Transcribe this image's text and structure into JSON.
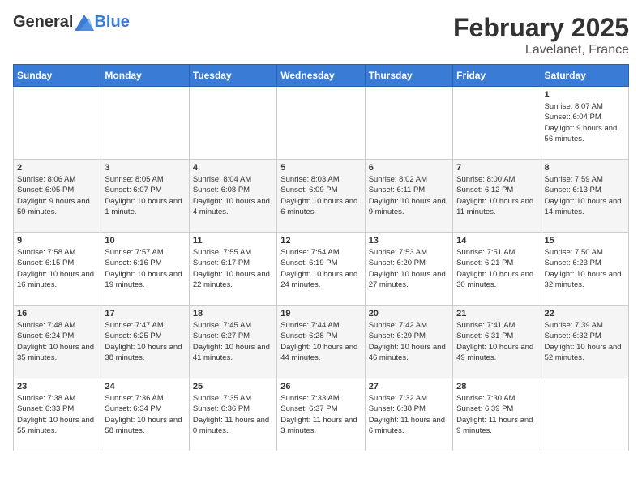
{
  "header": {
    "logo_general": "General",
    "logo_blue": "Blue",
    "title": "February 2025",
    "subtitle": "Lavelanet, France"
  },
  "columns": [
    "Sunday",
    "Monday",
    "Tuesday",
    "Wednesday",
    "Thursday",
    "Friday",
    "Saturday"
  ],
  "weeks": [
    [
      {
        "day": "",
        "info": ""
      },
      {
        "day": "",
        "info": ""
      },
      {
        "day": "",
        "info": ""
      },
      {
        "day": "",
        "info": ""
      },
      {
        "day": "",
        "info": ""
      },
      {
        "day": "",
        "info": ""
      },
      {
        "day": "1",
        "info": "Sunrise: 8:07 AM\nSunset: 6:04 PM\nDaylight: 9 hours and 56 minutes."
      }
    ],
    [
      {
        "day": "2",
        "info": "Sunrise: 8:06 AM\nSunset: 6:05 PM\nDaylight: 9 hours and 59 minutes."
      },
      {
        "day": "3",
        "info": "Sunrise: 8:05 AM\nSunset: 6:07 PM\nDaylight: 10 hours and 1 minute."
      },
      {
        "day": "4",
        "info": "Sunrise: 8:04 AM\nSunset: 6:08 PM\nDaylight: 10 hours and 4 minutes."
      },
      {
        "day": "5",
        "info": "Sunrise: 8:03 AM\nSunset: 6:09 PM\nDaylight: 10 hours and 6 minutes."
      },
      {
        "day": "6",
        "info": "Sunrise: 8:02 AM\nSunset: 6:11 PM\nDaylight: 10 hours and 9 minutes."
      },
      {
        "day": "7",
        "info": "Sunrise: 8:00 AM\nSunset: 6:12 PM\nDaylight: 10 hours and 11 minutes."
      },
      {
        "day": "8",
        "info": "Sunrise: 7:59 AM\nSunset: 6:13 PM\nDaylight: 10 hours and 14 minutes."
      }
    ],
    [
      {
        "day": "9",
        "info": "Sunrise: 7:58 AM\nSunset: 6:15 PM\nDaylight: 10 hours and 16 minutes."
      },
      {
        "day": "10",
        "info": "Sunrise: 7:57 AM\nSunset: 6:16 PM\nDaylight: 10 hours and 19 minutes."
      },
      {
        "day": "11",
        "info": "Sunrise: 7:55 AM\nSunset: 6:17 PM\nDaylight: 10 hours and 22 minutes."
      },
      {
        "day": "12",
        "info": "Sunrise: 7:54 AM\nSunset: 6:19 PM\nDaylight: 10 hours and 24 minutes."
      },
      {
        "day": "13",
        "info": "Sunrise: 7:53 AM\nSunset: 6:20 PM\nDaylight: 10 hours and 27 minutes."
      },
      {
        "day": "14",
        "info": "Sunrise: 7:51 AM\nSunset: 6:21 PM\nDaylight: 10 hours and 30 minutes."
      },
      {
        "day": "15",
        "info": "Sunrise: 7:50 AM\nSunset: 6:23 PM\nDaylight: 10 hours and 32 minutes."
      }
    ],
    [
      {
        "day": "16",
        "info": "Sunrise: 7:48 AM\nSunset: 6:24 PM\nDaylight: 10 hours and 35 minutes."
      },
      {
        "day": "17",
        "info": "Sunrise: 7:47 AM\nSunset: 6:25 PM\nDaylight: 10 hours and 38 minutes."
      },
      {
        "day": "18",
        "info": "Sunrise: 7:45 AM\nSunset: 6:27 PM\nDaylight: 10 hours and 41 minutes."
      },
      {
        "day": "19",
        "info": "Sunrise: 7:44 AM\nSunset: 6:28 PM\nDaylight: 10 hours and 44 minutes."
      },
      {
        "day": "20",
        "info": "Sunrise: 7:42 AM\nSunset: 6:29 PM\nDaylight: 10 hours and 46 minutes."
      },
      {
        "day": "21",
        "info": "Sunrise: 7:41 AM\nSunset: 6:31 PM\nDaylight: 10 hours and 49 minutes."
      },
      {
        "day": "22",
        "info": "Sunrise: 7:39 AM\nSunset: 6:32 PM\nDaylight: 10 hours and 52 minutes."
      }
    ],
    [
      {
        "day": "23",
        "info": "Sunrise: 7:38 AM\nSunset: 6:33 PM\nDaylight: 10 hours and 55 minutes."
      },
      {
        "day": "24",
        "info": "Sunrise: 7:36 AM\nSunset: 6:34 PM\nDaylight: 10 hours and 58 minutes."
      },
      {
        "day": "25",
        "info": "Sunrise: 7:35 AM\nSunset: 6:36 PM\nDaylight: 11 hours and 0 minutes."
      },
      {
        "day": "26",
        "info": "Sunrise: 7:33 AM\nSunset: 6:37 PM\nDaylight: 11 hours and 3 minutes."
      },
      {
        "day": "27",
        "info": "Sunrise: 7:32 AM\nSunset: 6:38 PM\nDaylight: 11 hours and 6 minutes."
      },
      {
        "day": "28",
        "info": "Sunrise: 7:30 AM\nSunset: 6:39 PM\nDaylight: 11 hours and 9 minutes."
      },
      {
        "day": "",
        "info": ""
      }
    ]
  ]
}
